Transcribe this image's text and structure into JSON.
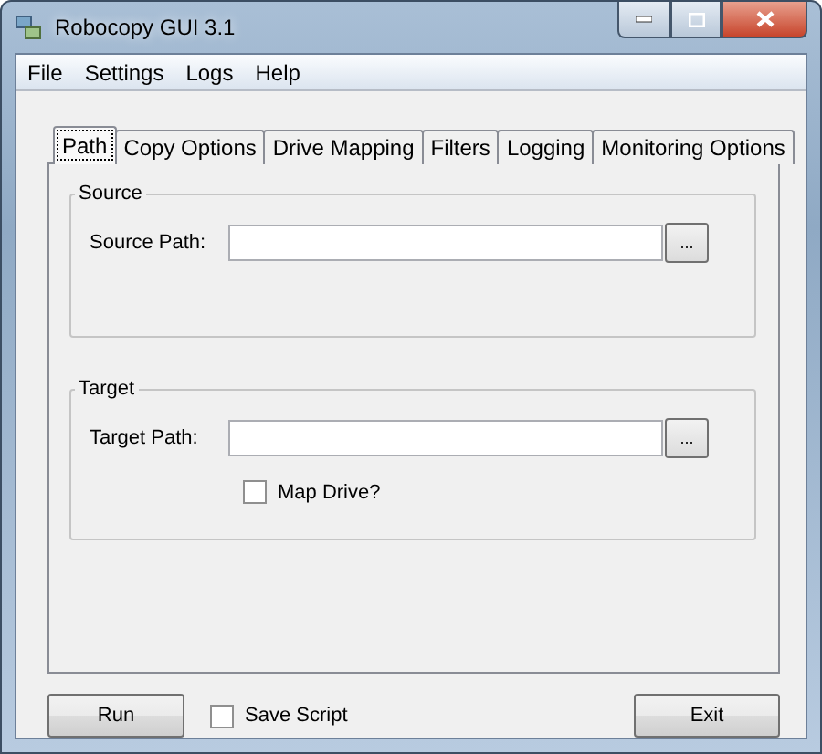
{
  "window": {
    "title": "Robocopy GUI 3.1"
  },
  "menu": [
    "File",
    "Settings",
    "Logs",
    "Help"
  ],
  "tabs": [
    {
      "label": "Path",
      "selected": true
    },
    {
      "label": "Copy Options",
      "selected": false
    },
    {
      "label": "Drive Mapping",
      "selected": false
    },
    {
      "label": "Filters",
      "selected": false
    },
    {
      "label": "Logging",
      "selected": false
    },
    {
      "label": "Monitoring Options",
      "selected": false
    }
  ],
  "groups": [
    {
      "title": "Source",
      "label": "Source Path:",
      "browse": "..."
    },
    {
      "title": "Target",
      "label": "Target Path:",
      "browse": "...",
      "checkbox": {
        "label": "Map Drive?",
        "checked": false
      }
    }
  ],
  "footer": {
    "run": "Run",
    "save_script": {
      "label": "Save Script",
      "checked": false
    },
    "exit": "Exit"
  }
}
